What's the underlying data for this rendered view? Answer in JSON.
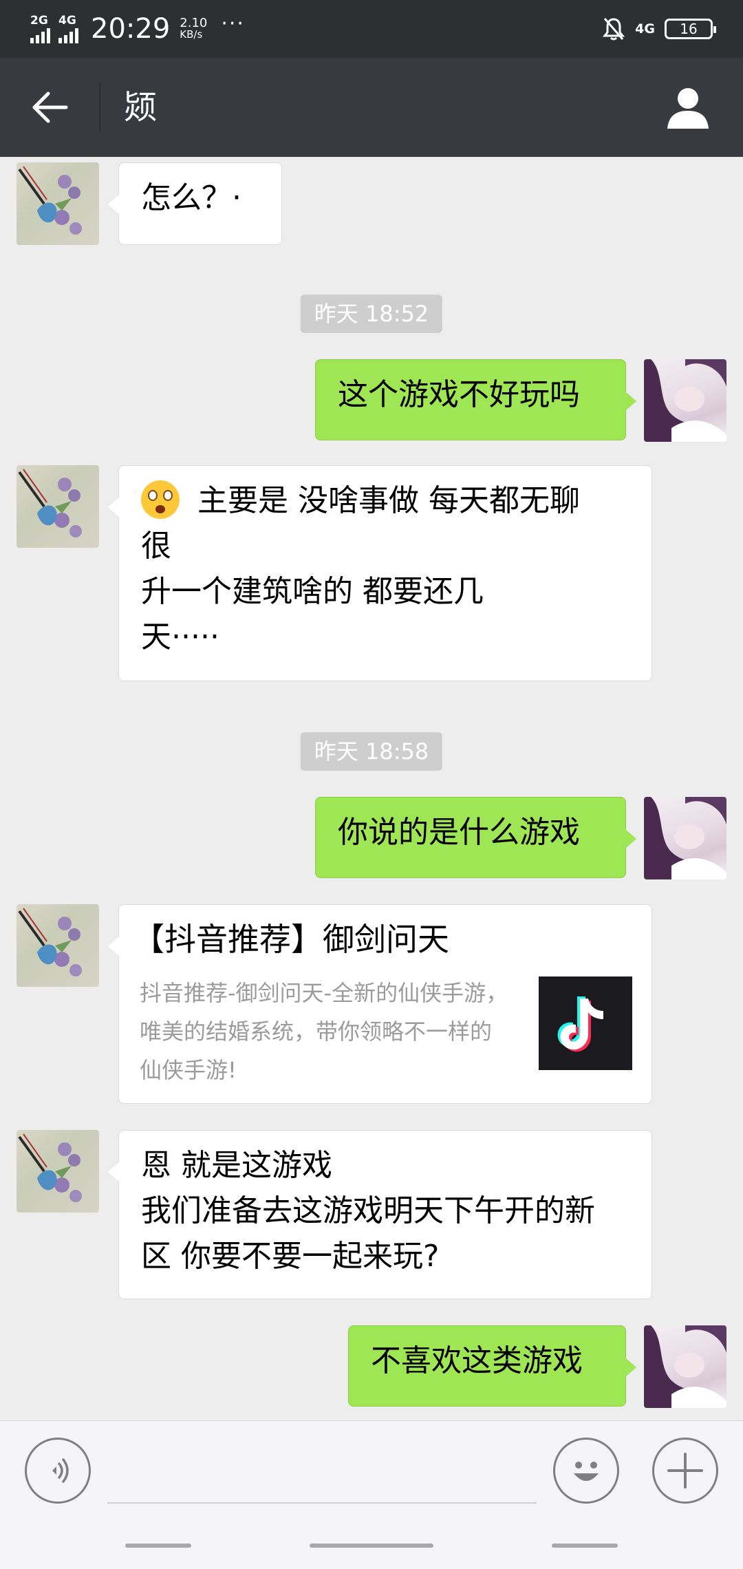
{
  "status_bar": {
    "network_1": "2G",
    "network_2": "4G",
    "time": "20:29",
    "speed_value": "2.10",
    "speed_unit": "KB/s",
    "more": "···",
    "network_right": "4G",
    "battery": "16"
  },
  "header": {
    "title": "颎"
  },
  "messages": {
    "m1": "怎么？·",
    "ts1": "昨天 18:52",
    "m2": "这个游戏不好玩吗",
    "m3_line1": "主要是  没啥事做  每天都无聊",
    "m3_line2": "很",
    "m3_line3": "  升一个建筑啥的  都要还几",
    "m3_line4": "天·····",
    "ts2": "昨天 18:58",
    "m4": "你说的是什么游戏",
    "card_title": "【抖音推荐】御剑问天",
    "card_desc": "抖音推荐-御剑问天-全新的仙侠手游，唯美的结婚系统，带你领略不一样的仙侠手游!",
    "m6_line1": "恩 就是这游戏",
    "m6_line2": "我们准备去这游戏明天下午开的新",
    "m6_line3": "区  你要不要一起来玩?",
    "m7": "不喜欢这类游戏"
  },
  "input": {
    "placeholder": ""
  },
  "icons": {
    "back": "arrow-left-icon",
    "contact": "person-icon",
    "voice": "voice-icon",
    "emoji": "smiley-icon",
    "plus": "plus-icon",
    "tiktok": "tiktok-logo-icon"
  },
  "colors": {
    "status_bar": "#2e2f31",
    "title_bar": "#393a3f",
    "chat_bg": "#ededed",
    "bubble_out": "#9ee654",
    "bubble_in": "#ffffff"
  }
}
